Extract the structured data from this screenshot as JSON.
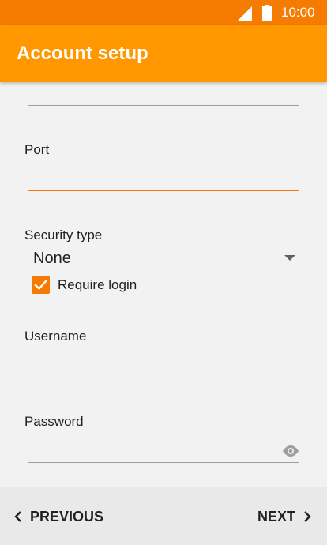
{
  "status_bar": {
    "time": "10:00",
    "signal_icon": "signal-icon",
    "battery_icon": "battery-icon"
  },
  "app_bar": {
    "title": "Account setup"
  },
  "form": {
    "port": {
      "label": "Port",
      "value": ""
    },
    "security_type": {
      "label": "Security type",
      "selected": "None"
    },
    "require_login": {
      "label": "Require login",
      "checked": true
    },
    "username": {
      "label": "Username",
      "value": ""
    },
    "password": {
      "label": "Password",
      "value": "",
      "toggle_icon": "eye-icon"
    }
  },
  "footer": {
    "previous_label": "PREVIOUS",
    "next_label": "NEXT"
  },
  "colors": {
    "status_bar": "#f57c00",
    "app_bar": "#ff9800",
    "accent": "#f57c00",
    "background": "#f2f2f2",
    "footer": "#e9e9e9"
  }
}
